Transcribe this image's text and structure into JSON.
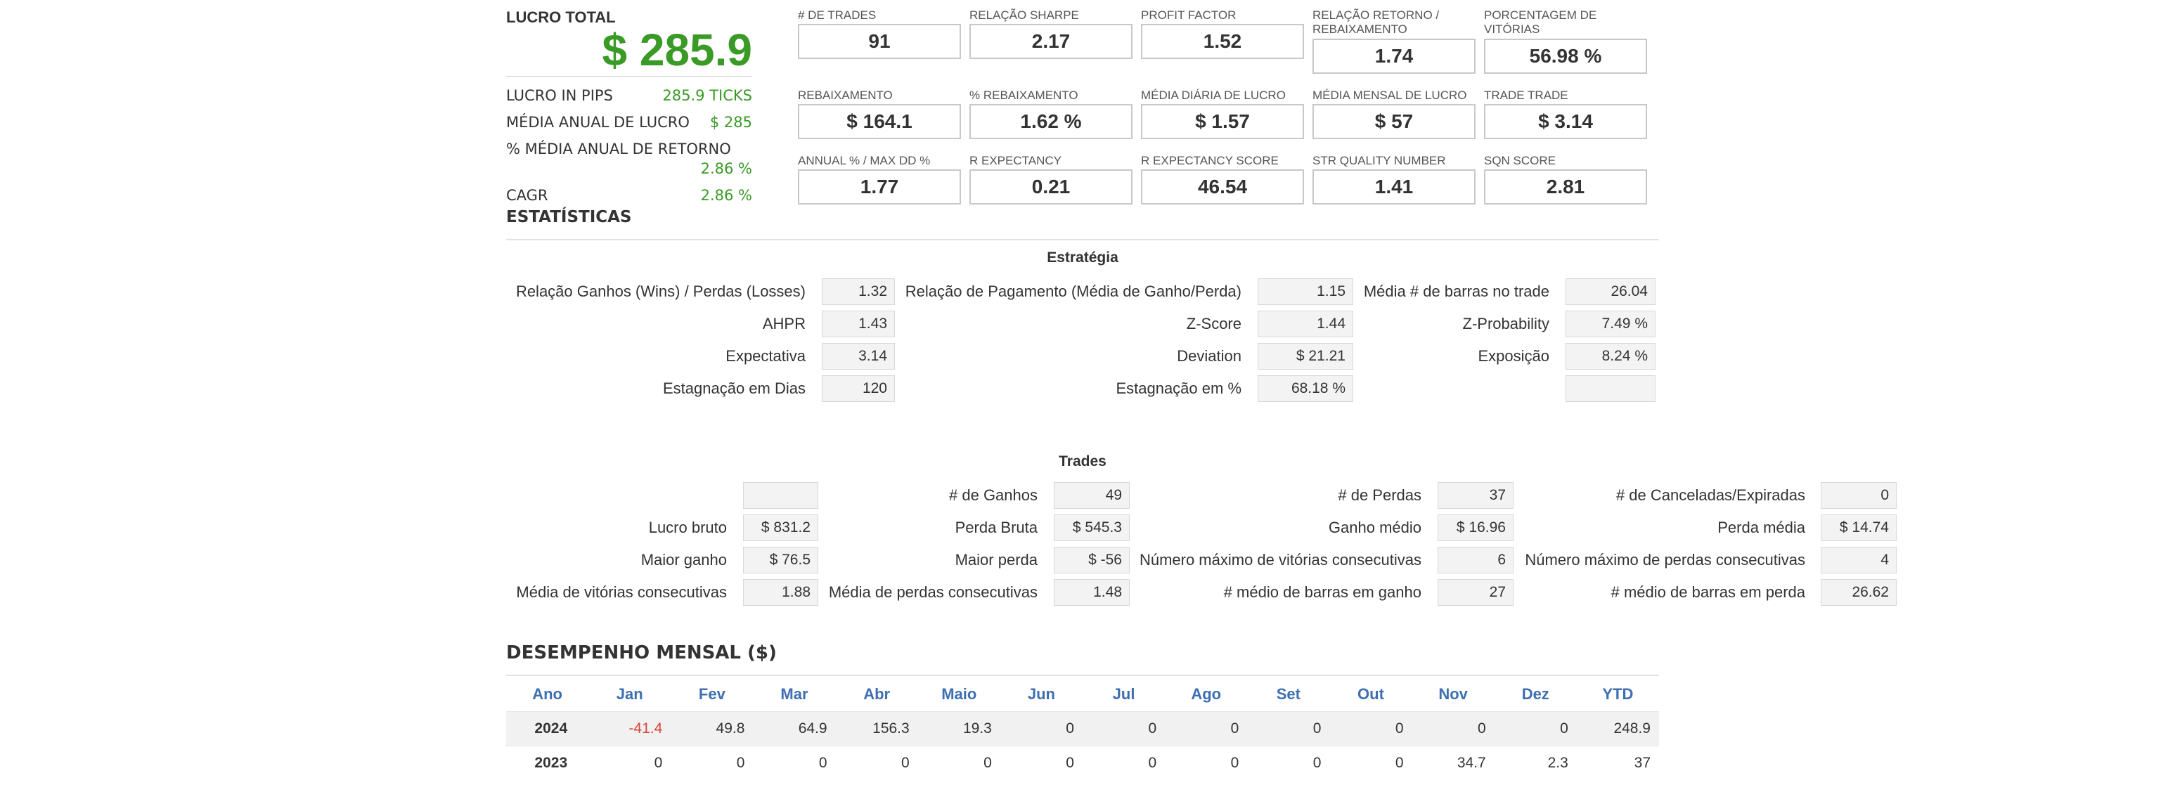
{
  "summary": {
    "title": "LUCRO TOTAL",
    "value": "$ 285.9",
    "rows": [
      {
        "label": "LUCRO IN PIPS",
        "value": "285.9 TICKS"
      },
      {
        "label": "MÉDIA ANUAL DE LUCRO",
        "value": "$ 285"
      },
      {
        "label": "% MÉDIA ANUAL DE RETORNO",
        "value": "2.86 %"
      },
      {
        "label": "CAGR",
        "value": "2.86 %"
      }
    ],
    "stats_heading": "ESTATÍSTICAS"
  },
  "cards": [
    {
      "label": "# DE TRADES",
      "value": "91"
    },
    {
      "label": "RELAÇÃO SHARPE",
      "value": "2.17"
    },
    {
      "label": "PROFIT FACTOR",
      "value": "1.52"
    },
    {
      "label": "RELAÇÃO RETORNO / REBAIXAMENTO",
      "value": "1.74"
    },
    {
      "label": "PORCENTAGEM DE VITÓRIAS",
      "value": "56.98 %"
    },
    {
      "label": "REBAIXAMENTO",
      "value": "$ 164.1"
    },
    {
      "label": "% REBAIXAMENTO",
      "value": "1.62 %"
    },
    {
      "label": "MÉDIA DIÁRIA DE LUCRO",
      "value": "$ 1.57"
    },
    {
      "label": "MÉDIA MENSAL DE LUCRO",
      "value": "$ 57"
    },
    {
      "label": "TRADE TRADE",
      "value": "$ 3.14"
    },
    {
      "label": "ANNUAL % / MAX DD %",
      "value": "1.77"
    },
    {
      "label": "R EXPECTANCY",
      "value": "0.21"
    },
    {
      "label": "R EXPECTANCY SCORE",
      "value": "46.54"
    },
    {
      "label": "STR QUALITY NUMBER",
      "value": "1.41"
    },
    {
      "label": "SQN SCORE",
      "value": "2.81"
    }
  ],
  "strategy": {
    "title": "Estratégia",
    "rows": [
      [
        {
          "label": "Relação Ganhos (Wins) / Perdas (Losses)",
          "value": "1.32"
        },
        {
          "label": "Relação de Pagamento (Média de Ganho/Perda)",
          "value": "1.15"
        },
        {
          "label": "Média # de barras no trade",
          "value": "26.04"
        }
      ],
      [
        {
          "label": "AHPR",
          "value": "1.43"
        },
        {
          "label": "Z-Score",
          "value": "1.44"
        },
        {
          "label": "Z-Probability",
          "value": "7.49 %"
        }
      ],
      [
        {
          "label": "Expectativa",
          "value": "3.14"
        },
        {
          "label": "Deviation",
          "value": "$ 21.21"
        },
        {
          "label": "Exposição",
          "value": "8.24 %"
        }
      ],
      [
        {
          "label": "Estagnação em Dias",
          "value": "120"
        },
        {
          "label": "Estagnação em %",
          "value": "68.18 %"
        },
        {
          "label": "",
          "value": ""
        }
      ]
    ]
  },
  "trades": {
    "title": "Trades",
    "rows": [
      [
        {
          "label": "",
          "value": ""
        },
        {
          "label": "# de Ganhos",
          "value": "49"
        },
        {
          "label": "# de Perdas",
          "value": "37"
        },
        {
          "label": "# de Canceladas/Expiradas",
          "value": "0"
        }
      ],
      [
        {
          "label": "Lucro bruto",
          "value": "$ 831.2"
        },
        {
          "label": "Perda Bruta",
          "value": "$ 545.3"
        },
        {
          "label": "Ganho médio",
          "value": "$ 16.96"
        },
        {
          "label": "Perda média",
          "value": "$ 14.74"
        }
      ],
      [
        {
          "label": "Maior ganho",
          "value": "$ 76.5"
        },
        {
          "label": "Maior perda",
          "value": "$ -56"
        },
        {
          "label": "Número máximo de vitórias consecutivas",
          "value": "6"
        },
        {
          "label": "Número máximo de perdas consecutivas",
          "value": "4"
        }
      ],
      [
        {
          "label": "Média de vitórias consecutivas",
          "value": "1.88"
        },
        {
          "label": "Média de perdas consecutivas",
          "value": "1.48"
        },
        {
          "label": "# médio de barras em ganho",
          "value": "27"
        },
        {
          "label": "# médio de barras em perda",
          "value": "26.62"
        }
      ]
    ]
  },
  "monthly": {
    "title": "DESEMPENHO MENSAL ($)",
    "headers": [
      "Ano",
      "Jan",
      "Fev",
      "Mar",
      "Abr",
      "Maio",
      "Jun",
      "Jul",
      "Ago",
      "Set",
      "Out",
      "Nov",
      "Dez",
      "YTD"
    ],
    "rows": [
      {
        "year": "2024",
        "values": [
          "-41.4",
          "49.8",
          "64.9",
          "156.3",
          "19.3",
          "0",
          "0",
          "0",
          "0",
          "0",
          "0",
          "0",
          "248.9"
        ]
      },
      {
        "year": "2023",
        "values": [
          "0",
          "0",
          "0",
          "0",
          "0",
          "0",
          "0",
          "0",
          "0",
          "0",
          "34.7",
          "2.3",
          "37"
        ]
      }
    ]
  },
  "colors": {
    "profit_green": "#3a9a26",
    "negative_red": "#d9453a",
    "header_blue": "#3d6fb1"
  }
}
